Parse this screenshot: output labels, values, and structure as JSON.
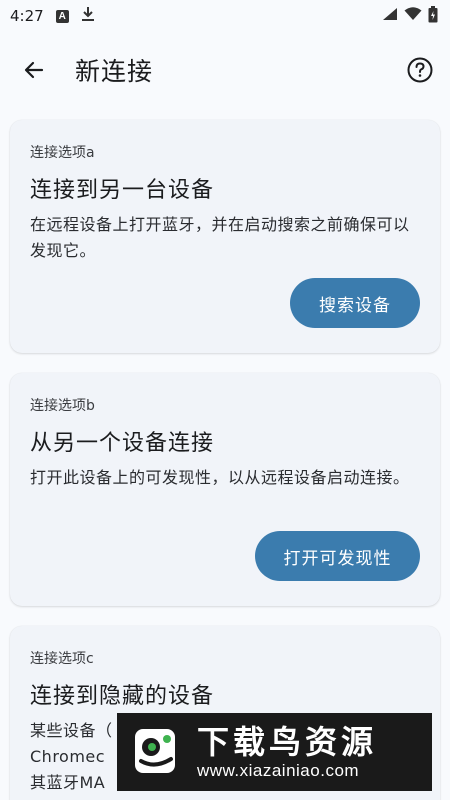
{
  "status": {
    "time": "4:27",
    "notif_a": "A"
  },
  "header": {
    "title": "新连接"
  },
  "cards": [
    {
      "label": "连接选项a",
      "title": "连接到另一台设备",
      "description": "在远程设备上打开蓝牙，并在启动搜索之前确保可以发现它。",
      "button": "搜索设备"
    },
    {
      "label": "连接选项b",
      "title": "从另一个设备连接",
      "description": "打开此设备上的可发现性，以从远程设备启动连接。",
      "button": "打开可发现性"
    },
    {
      "label": "连接选项c",
      "title": "连接到隐藏的设备",
      "description_line1": "某些设备（",
      "description_line2": "Chromec",
      "description_line3": "其蓝牙MA"
    }
  ],
  "watermark": {
    "title": "下载鸟资源",
    "url": "www.xiazainiao.com"
  },
  "colors": {
    "accent": "#3b7cae",
    "card_bg": "#f1f4f9",
    "page_bg": "#f8fafd"
  }
}
